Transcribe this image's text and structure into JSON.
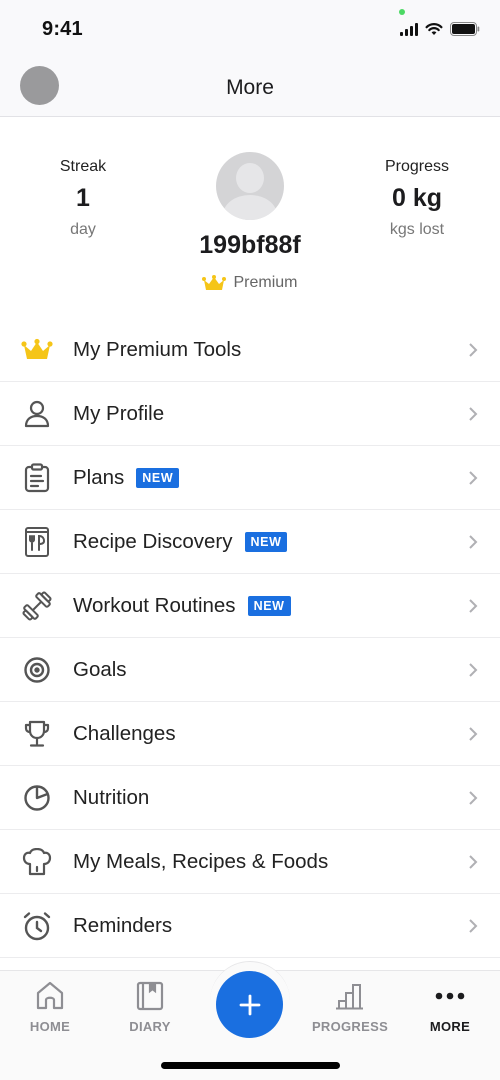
{
  "status_bar": {
    "time": "9:41"
  },
  "header": {
    "title": "More"
  },
  "profile": {
    "streak": {
      "label": "Streak",
      "value": "1",
      "unit": "day"
    },
    "progress": {
      "label": "Progress",
      "value": "0 kg",
      "unit": "kgs lost"
    },
    "username": "199bf88f",
    "membership": "Premium"
  },
  "menu": {
    "items": [
      {
        "label": "My Premium Tools",
        "icon": "crown-icon",
        "badge": null
      },
      {
        "label": "My Profile",
        "icon": "person-icon",
        "badge": null
      },
      {
        "label": "Plans",
        "icon": "clipboard-icon",
        "badge": "NEW"
      },
      {
        "label": "Recipe Discovery",
        "icon": "recipe-book-icon",
        "badge": "NEW"
      },
      {
        "label": "Workout Routines",
        "icon": "dumbbell-icon",
        "badge": "NEW"
      },
      {
        "label": "Goals",
        "icon": "target-icon",
        "badge": null
      },
      {
        "label": "Challenges",
        "icon": "trophy-icon",
        "badge": null
      },
      {
        "label": "Nutrition",
        "icon": "pie-chart-icon",
        "badge": null
      },
      {
        "label": "My Meals, Recipes & Foods",
        "icon": "chef-hat-icon",
        "badge": null
      },
      {
        "label": "Reminders",
        "icon": "alarm-clock-icon",
        "badge": null
      }
    ]
  },
  "tab_bar": {
    "tabs": [
      {
        "label": "HOME",
        "icon": "home-icon",
        "active": false
      },
      {
        "label": "DIARY",
        "icon": "diary-icon",
        "active": false
      },
      {
        "label": "PROGRESS",
        "icon": "bar-chart-icon",
        "active": false
      },
      {
        "label": "MORE",
        "icon": "more-dots-icon",
        "active": true
      }
    ],
    "add_button": "add-icon"
  },
  "colors": {
    "accent": "#1a6fe0",
    "premium_gold": "#f5c518",
    "icon_gray": "#555555"
  }
}
